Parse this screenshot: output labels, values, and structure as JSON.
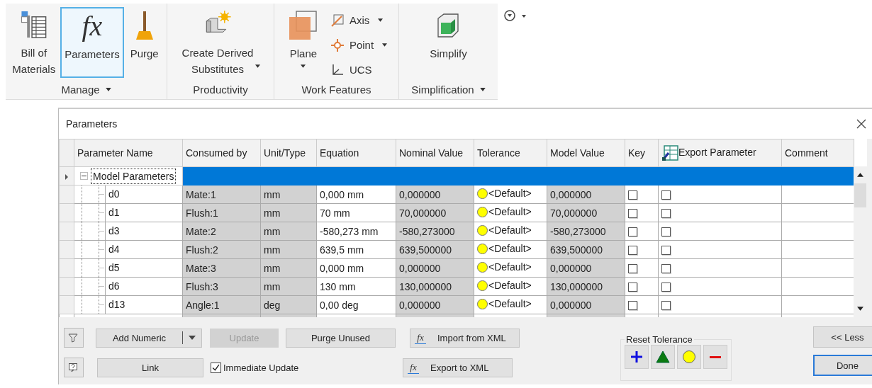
{
  "ribbon": {
    "groups": [
      {
        "label": "Manage",
        "menu": true,
        "items": [
          {
            "kind": "bom",
            "label": "Bill of\nMaterials",
            "selected": false,
            "dropdown": false
          },
          {
            "kind": "fx",
            "glyph": "fx",
            "label": "Parameters",
            "selected": true,
            "dropdown": false
          },
          {
            "kind": "purge",
            "label": "Purge",
            "selected": false,
            "dropdown": false
          }
        ]
      },
      {
        "label": "Productivity",
        "menu": false,
        "items": [
          {
            "kind": "derived",
            "label": "Create Derived\nSubstitutes",
            "selected": false,
            "dropdown": true
          }
        ]
      },
      {
        "label": "Work Features",
        "menu": false,
        "items": [
          {
            "kind": "plane",
            "label": "Plane",
            "selected": false,
            "dropdown": true
          }
        ],
        "small_items": [
          {
            "kind": "axis",
            "label": "Axis",
            "dropdown": true
          },
          {
            "kind": "point",
            "label": "Point",
            "dropdown": true
          },
          {
            "kind": "ucs",
            "label": "UCS",
            "dropdown": false
          }
        ]
      },
      {
        "label": "Simplification",
        "menu": true,
        "items": [
          {
            "kind": "simplify",
            "label": "Simplify",
            "selected": false,
            "dropdown": false
          }
        ]
      }
    ]
  },
  "dialog": {
    "title": "Parameters",
    "columns": [
      "Parameter Name",
      "Consumed by",
      "Unit/Type",
      "Equation",
      "Nominal Value",
      "Tolerance",
      "Model Value",
      "Key",
      "Export Parameter",
      "Comment"
    ],
    "group": {
      "label": "Model Parameters",
      "expanded": true,
      "selected": true
    },
    "rows": [
      {
        "name": "d0",
        "consumed_by": "Mate:1",
        "unit": "mm",
        "equation": "0,000 mm",
        "nominal": "0,000000",
        "tolerance": "<Default>",
        "model_value": "0,000000",
        "key": false,
        "export": false
      },
      {
        "name": "d1",
        "consumed_by": "Flush:1",
        "unit": "mm",
        "equation": "70 mm",
        "nominal": "70,000000",
        "tolerance": "<Default>",
        "model_value": "70,000000",
        "key": false,
        "export": false
      },
      {
        "name": "d3",
        "consumed_by": "Mate:2",
        "unit": "mm",
        "equation": "-580,273 mm",
        "nominal": "-580,273000",
        "tolerance": "<Default>",
        "model_value": "-580,273000",
        "key": false,
        "export": false
      },
      {
        "name": "d4",
        "consumed_by": "Flush:2",
        "unit": "mm",
        "equation": "639,5 mm",
        "nominal": "639,500000",
        "tolerance": "<Default>",
        "model_value": "639,500000",
        "key": false,
        "export": false
      },
      {
        "name": "d5",
        "consumed_by": "Mate:3",
        "unit": "mm",
        "equation": "0,000 mm",
        "nominal": "0,000000",
        "tolerance": "<Default>",
        "model_value": "0,000000",
        "key": false,
        "export": false
      },
      {
        "name": "d6",
        "consumed_by": "Flush:3",
        "unit": "mm",
        "equation": "130 mm",
        "nominal": "130,000000",
        "tolerance": "<Default>",
        "model_value": "130,000000",
        "key": false,
        "export": false
      },
      {
        "name": "d13",
        "consumed_by": "Angle:1",
        "unit": "deg",
        "equation": "0,00 deg",
        "nominal": "0,000000",
        "tolerance": "<Default>",
        "model_value": "0,000000",
        "key": false,
        "export": false
      }
    ],
    "controls": {
      "add_numeric": "Add Numeric",
      "update": {
        "label": "Update",
        "disabled": true
      },
      "purge_unused": "Purge Unused",
      "import_xml": {
        "glyph": "fx",
        "label": "Import from XML"
      },
      "link": "Link",
      "immediate_update": {
        "label": "Immediate Update",
        "checked": true
      },
      "export_xml": {
        "glyph": "fx",
        "label": "Export to XML"
      },
      "reset_tolerance": "Reset Tolerance",
      "less": "<< Less",
      "done": {
        "label": "Done",
        "default": true
      }
    }
  }
}
